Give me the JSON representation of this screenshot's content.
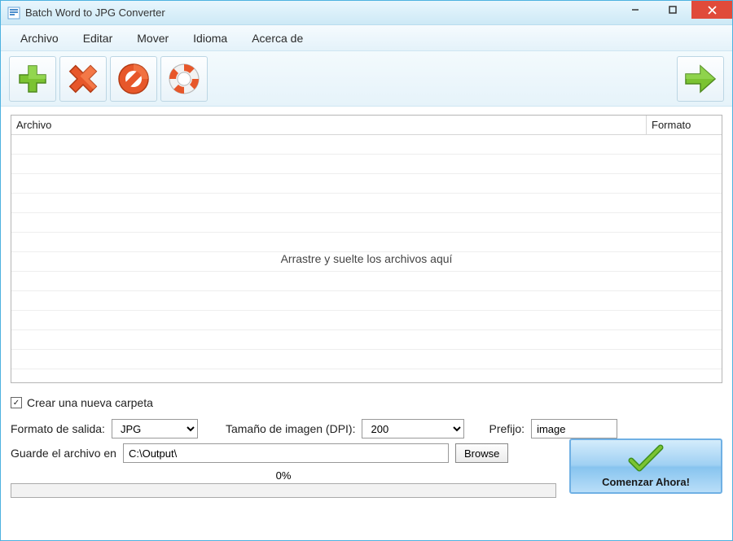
{
  "window": {
    "title": "Batch Word to JPG Converter"
  },
  "menu": {
    "items": [
      "Archivo",
      "Editar",
      "Mover",
      "Idioma",
      "Acerca de"
    ]
  },
  "toolbar": {
    "add": "add-icon",
    "remove": "remove-icon",
    "clear": "clear-icon",
    "help": "help-icon",
    "convert": "convert-icon"
  },
  "grid": {
    "col_file": "Archivo",
    "col_format": "Formato",
    "drop_hint": "Arrastre y suelte los archivos aquí"
  },
  "options": {
    "new_folder_label": "Crear una nueva carpeta",
    "new_folder_checked": true,
    "format_label": "Formato de salida:",
    "format_value": "JPG",
    "dpi_label": "Tamaño de imagen (DPI):",
    "dpi_value": "200",
    "prefix_label": "Prefijo:",
    "prefix_value": "image",
    "save_label": "Guarde el archivo en",
    "save_path": "C:\\Output\\",
    "browse_label": "Browse"
  },
  "progress": {
    "percent_label": "0%"
  },
  "start": {
    "label": "Comenzar Ahora!"
  }
}
